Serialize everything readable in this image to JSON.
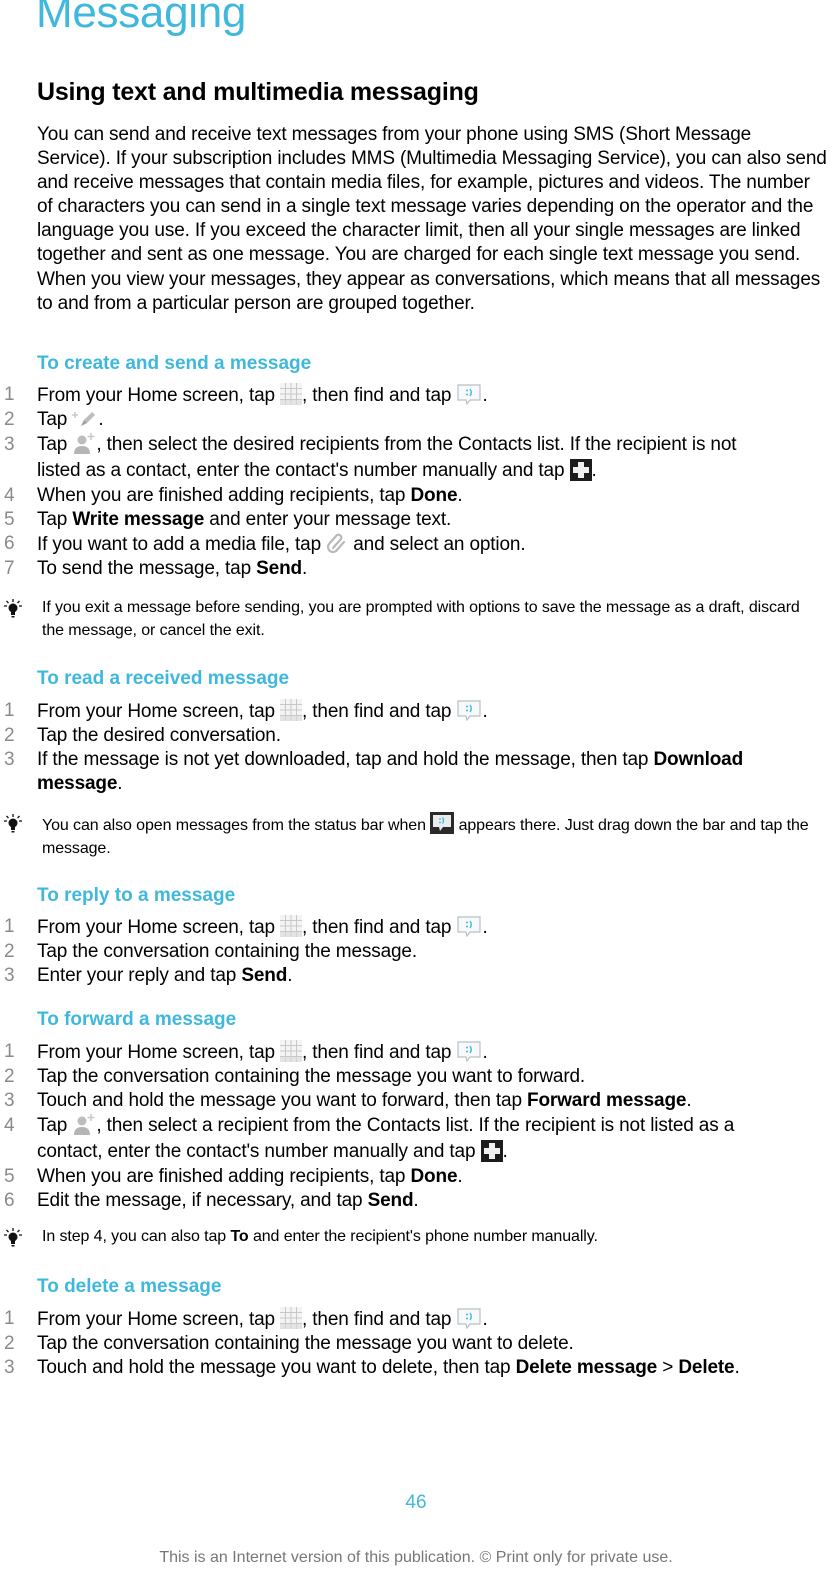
{
  "page_title": "Messaging",
  "section_heading": "Using text and multimedia messaging",
  "intro": "You can send and receive text messages from your phone using SMS (Short Message Service). If your subscription includes MMS (Multimedia Messaging Service), you can also send and receive messages that contain media files, for example, pictures and videos. The number of characters you can send in a single text message varies depending on the operator and the language you use. If you exceed the character limit, then all your single messages are linked together and sent as one message. You are charged for each single text message you send. When you view your messages, they appear as conversations, which means that all messages to and from a particular person are grouped together.",
  "colors": {
    "accent": "#3fb8dd",
    "step_number": "#8a8a8a",
    "footer": "#777777"
  },
  "sections": {
    "create": {
      "heading": "To create and send a message",
      "steps": [
        {
          "num": "1",
          "a": "From your Home screen, tap ",
          "b": ", then find and tap ",
          "c": "."
        },
        {
          "num": "2",
          "a": "Tap ",
          "b": "."
        },
        {
          "num": "3",
          "a": "Tap ",
          "b": ", then select the desired recipients from the Contacts list. If the recipient is not listed as a contact, enter the contact's number manually and tap ",
          "c": "."
        },
        {
          "num": "4",
          "a": "When you are finished adding recipients, tap ",
          "bold": "Done",
          "c": "."
        },
        {
          "num": "5",
          "a": "Tap ",
          "bold": "Write message",
          "c": " and enter your message text."
        },
        {
          "num": "6",
          "a": "If you want to add a media file, tap ",
          "b": " and select an option."
        },
        {
          "num": "7",
          "a": "To send the message, tap ",
          "bold": "Send",
          "c": "."
        }
      ],
      "tip": "If you exit a message before sending, you are prompted with options to save the message as a draft, discard the message, or cancel the exit."
    },
    "read": {
      "heading": "To read a received message",
      "steps": [
        {
          "num": "1",
          "a": "From your Home screen, tap ",
          "b": ", then find and tap ",
          "c": "."
        },
        {
          "num": "2",
          "a": "Tap the desired conversation."
        },
        {
          "num": "3",
          "a": "If the message is not yet downloaded, tap and hold the message, then tap ",
          "bold": "Download message",
          "c": "."
        }
      ],
      "tip_a": "You can also open messages from the status bar when ",
      "tip_b": " appears there. Just drag down the bar and tap the message."
    },
    "reply": {
      "heading": "To reply to a message",
      "steps": [
        {
          "num": "1",
          "a": "From your Home screen, tap ",
          "b": ", then find and tap ",
          "c": "."
        },
        {
          "num": "2",
          "a": "Tap the conversation containing the message."
        },
        {
          "num": "3",
          "a": "Enter your reply and tap ",
          "bold": "Send",
          "c": "."
        }
      ]
    },
    "forward": {
      "heading": "To forward a message",
      "steps": [
        {
          "num": "1",
          "a": "From your Home screen, tap ",
          "b": ", then find and tap ",
          "c": "."
        },
        {
          "num": "2",
          "a": "Tap the conversation containing the message you want to forward."
        },
        {
          "num": "3",
          "a": "Touch and hold the message you want to forward, then tap ",
          "bold": "Forward message",
          "c": "."
        },
        {
          "num": "4",
          "a": "Tap ",
          "b": ", then select a recipient from the Contacts list. If the recipient is not listed as a contact, enter the contact's number manually and tap ",
          "c": "."
        },
        {
          "num": "5",
          "a": "When you are finished adding recipients, tap ",
          "bold": "Done",
          "c": "."
        },
        {
          "num": "6",
          "a": "Edit the message, if necessary, and tap ",
          "bold": "Send",
          "c": "."
        }
      ],
      "tip_a": "In step 4, you can also tap ",
      "tip_bold": "To",
      "tip_b": " and enter the recipient's phone number manually."
    },
    "delete": {
      "heading": "To delete a message",
      "steps": [
        {
          "num": "1",
          "a": "From your Home screen, tap ",
          "b": ", then find and tap ",
          "c": "."
        },
        {
          "num": "2",
          "a": "Tap the conversation containing the message you want to delete."
        },
        {
          "num": "3",
          "a": "Touch and hold the message you want to delete, then tap ",
          "bold": "Delete message",
          "mid": " > ",
          "bold2": "Delete",
          "c": "."
        }
      ]
    }
  },
  "icons": {
    "apps": "application-grid-icon",
    "messaging": "messaging-app-icon",
    "new_message": "new-message-icon",
    "add_contact": "add-contact-icon",
    "plus": "plus-button-icon",
    "attach": "paperclip-attach-icon",
    "status": "status-bar-message-icon",
    "tip": "lightbulb-tip-icon"
  },
  "footer": {
    "page_number": "46",
    "notice": "This is an Internet version of this publication. © Print only for private use."
  }
}
